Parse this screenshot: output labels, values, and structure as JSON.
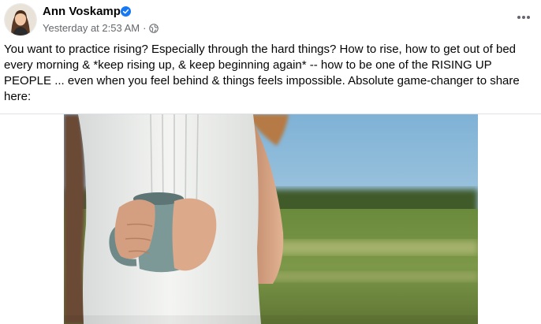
{
  "post": {
    "author": "Ann Voskamp",
    "timestamp": "Yesterday at 2:53 AM",
    "separator": "·",
    "body": "You want to practice rising?  Especially through the hard things? How to rise, how to get out of bed every morning & *keep rising up, & keep beginning again* -- how to be one of the RISING UP PEOPLE ... even when you feel behind & things feels impossible. Absolute game-changer to share here:"
  },
  "icons": {
    "verified": "verified-badge-icon",
    "audience": "globe-icon",
    "more": "more-options-icon"
  },
  "colors": {
    "verified": "#1877f2",
    "meta": "#65676b",
    "text": "#050505"
  }
}
